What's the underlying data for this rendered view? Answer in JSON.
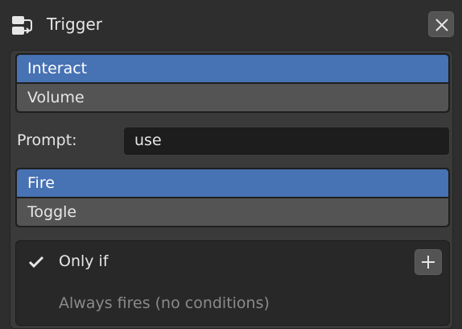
{
  "header": {
    "title": "Trigger",
    "icon": "trigger-node-icon",
    "close_icon": "close-icon"
  },
  "trigger_type": {
    "options": [
      "Interact",
      "Volume"
    ],
    "selected": "Interact"
  },
  "prompt": {
    "label": "Prompt:",
    "value": "use"
  },
  "action": {
    "options": [
      "Fire",
      "Toggle"
    ],
    "selected": "Fire"
  },
  "conditions": {
    "checked": true,
    "label": "Only if",
    "add_icon": "plus-icon",
    "hint": "Always fires (no conditions)"
  },
  "colors": {
    "accent": "#4772b3",
    "background": "#2e2e2e",
    "panel": "#3a3a3a"
  }
}
